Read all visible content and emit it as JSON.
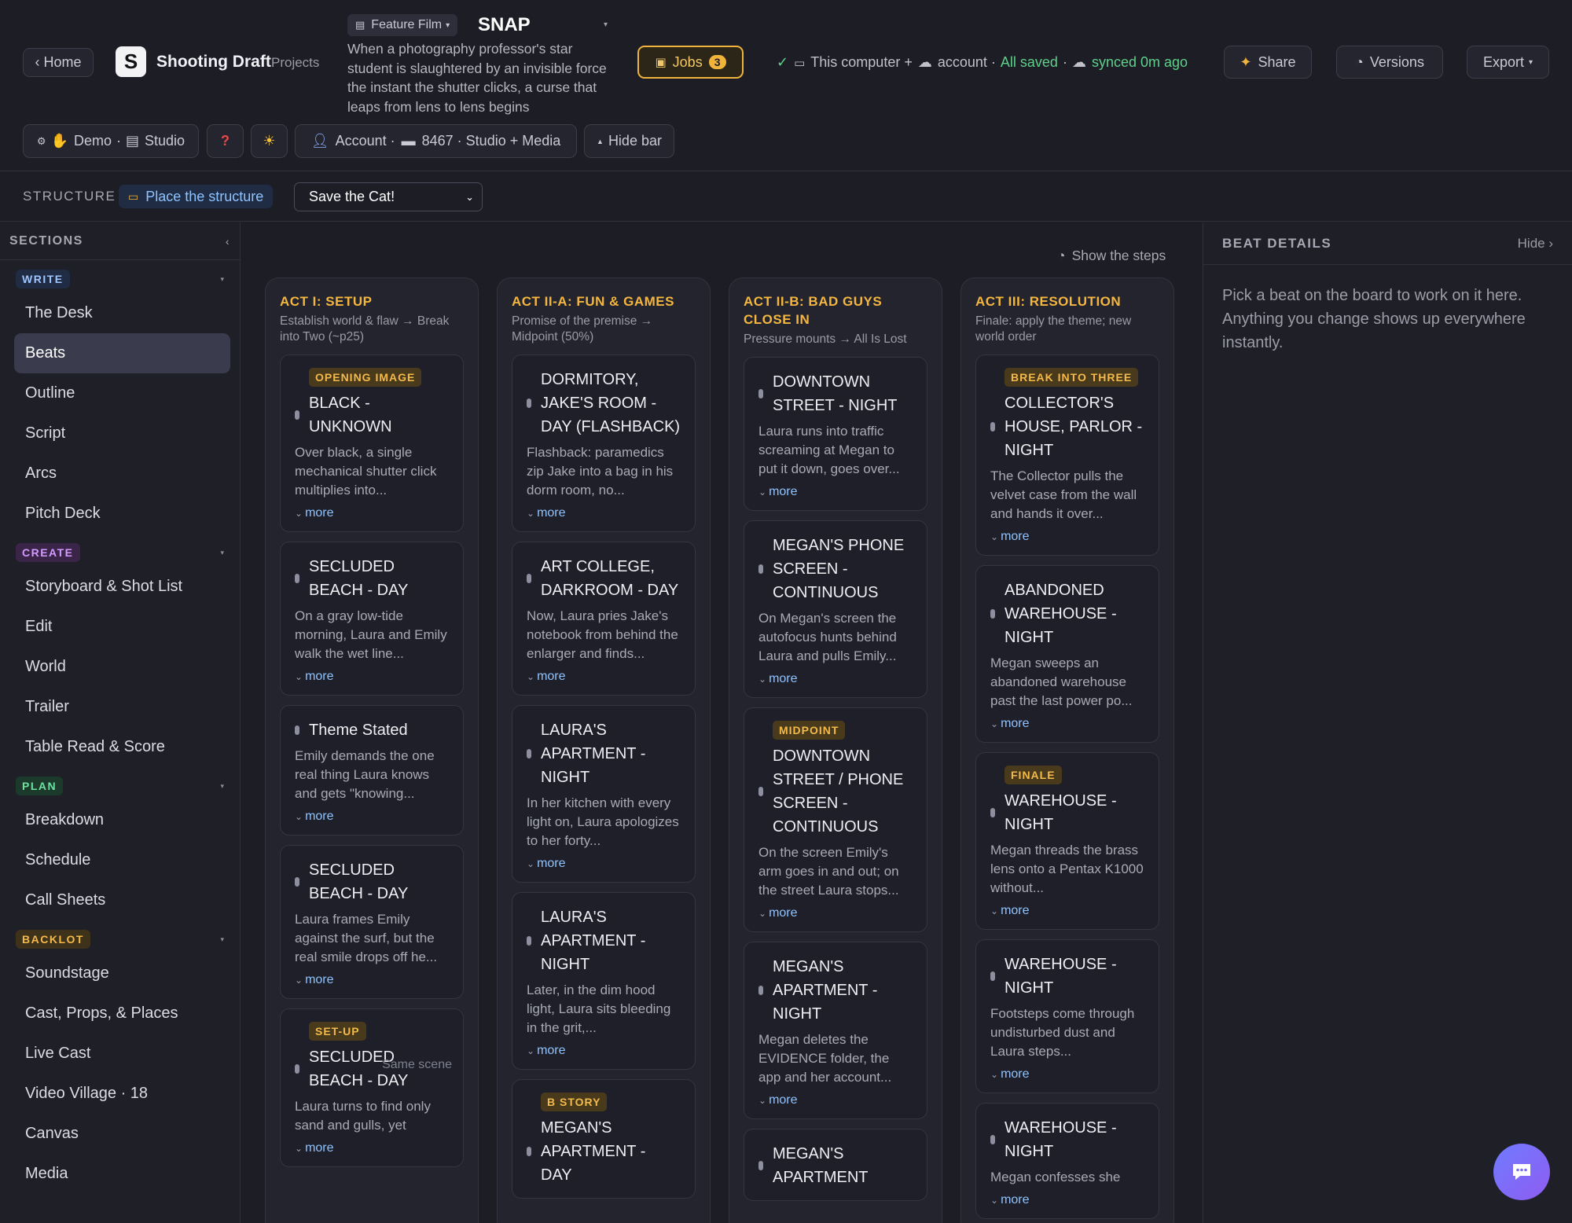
{
  "header": {
    "home_label": "‹ Home",
    "app_name": "Shooting Draft",
    "projects_label": "Projects",
    "project_type": "Feature Film",
    "project_title": "SNAP",
    "logline": "When a photography professor's star student is slaughtered by an invisible force the instant the shutter clicks, a curse that leaps from lens to lens begins",
    "jobs_label": "Jobs",
    "jobs_count": "3",
    "sync_computer": "This computer +",
    "sync_account": "account ·",
    "sync_saved": "All saved",
    "sync_synced": "synced 0m ago",
    "share_label": "Share",
    "versions_label": "Versions",
    "export_label": "Export",
    "demo_label": "Demo",
    "studio_label": "Studio",
    "account_label": "Account ·",
    "plan_label": "8467 · Studio + Media",
    "hide_bar_label": "Hide bar"
  },
  "structure": {
    "label": "STRUCTURE",
    "place_label": "Place the structure",
    "selected": "Save the Cat!"
  },
  "sidebar": {
    "title": "SECTIONS",
    "groups": [
      {
        "name": "WRITE",
        "color": "#9fc5ff",
        "bg": "#1f2c44",
        "items": [
          "The Desk",
          "Beats",
          "Outline",
          "Script",
          "Arcs",
          "Pitch Deck"
        ]
      },
      {
        "name": "CREATE",
        "color": "#d49bff",
        "bg": "#3a2548",
        "items": [
          "Storyboard & Shot List",
          "Edit",
          "World",
          "Trailer",
          "Table Read & Score"
        ]
      },
      {
        "name": "PLAN",
        "color": "#6fe0a0",
        "bg": "#1c3a2b",
        "items": [
          "Breakdown",
          "Schedule",
          "Call Sheets"
        ]
      },
      {
        "name": "BACKLOT",
        "color": "#f3b94a",
        "bg": "#3f321a",
        "items": [
          "Soundstage",
          "Cast, Props, & Places",
          "Live Cast",
          "Video Village · 18",
          "Canvas",
          "Media"
        ]
      }
    ],
    "active": "Beats"
  },
  "board": {
    "show_steps_label": "Show the steps",
    "more_label": "more",
    "columns": [
      {
        "title": "ACT I: SETUP",
        "subtitle": "Establish world & flaw → Break into Two (~p25)",
        "cards": [
          {
            "tag": "OPENING IMAGE",
            "scene": "BLACK - UNKNOWN",
            "desc": "Over black, a single mechanical shutter click multiplies into..."
          },
          {
            "tag": "",
            "scene": "SECLUDED BEACH - DAY",
            "desc": "On a gray low-tide morning, Laura and Emily walk the wet line..."
          },
          {
            "tag": "",
            "scene": "Theme Stated",
            "desc": "Emily demands the one real thing Laura knows and gets \"knowing..."
          },
          {
            "tag": "",
            "scene": "SECLUDED BEACH - DAY",
            "desc": "Laura frames Emily against the surf, but the real smile drops off he..."
          },
          {
            "tag": "SET-UP",
            "scene": "SECLUDED BEACH - DAY",
            "note": "Same scene",
            "desc": "Laura turns to find only sand and gulls, yet"
          }
        ]
      },
      {
        "title": "ACT II-A: FUN & GAMES",
        "subtitle": "Promise of the premise → Midpoint (50%)",
        "cards": [
          {
            "tag": "",
            "scene": "DORMITORY, JAKE'S ROOM - DAY (FLASHBACK)",
            "desc": "Flashback: paramedics zip Jake into a bag in his dorm room, no..."
          },
          {
            "tag": "",
            "scene": "ART COLLEGE, DARKROOM - DAY",
            "desc": "Now, Laura pries Jake's notebook from behind the enlarger and finds..."
          },
          {
            "tag": "",
            "scene": "LAURA'S APARTMENT - NIGHT",
            "desc": "In her kitchen with every light on, Laura apologizes to her forty..."
          },
          {
            "tag": "",
            "scene": "LAURA'S APARTMENT - NIGHT",
            "desc": "Later, in the dim hood light, Laura sits bleeding in the grit,..."
          },
          {
            "tag": "B STORY",
            "scene": "MEGAN'S APARTMENT - DAY",
            "desc": ""
          }
        ]
      },
      {
        "title": "ACT II-B: BAD GUYS CLOSE IN",
        "subtitle": "Pressure mounts → All Is Lost",
        "cards": [
          {
            "tag": "",
            "scene": "DOWNTOWN STREET - NIGHT",
            "desc": "Laura runs into traffic screaming at Megan to put it down, goes over..."
          },
          {
            "tag": "",
            "scene": "MEGAN'S PHONE SCREEN - CONTINUOUS",
            "desc": "On Megan's screen the autofocus hunts behind Laura and pulls Emily..."
          },
          {
            "tag": "MIDPOINT",
            "scene": "DOWNTOWN STREET / PHONE SCREEN - CONTINUOUS",
            "desc": "On the screen Emily's arm goes in and out; on the street Laura stops..."
          },
          {
            "tag": "",
            "scene": "MEGAN'S APARTMENT - NIGHT",
            "desc": "Megan deletes the EVIDENCE folder, the app and her account..."
          },
          {
            "tag": "",
            "scene": "MEGAN'S APARTMENT",
            "desc": ""
          }
        ]
      },
      {
        "title": "ACT III: RESOLUTION",
        "subtitle": "Finale: apply the theme; new world order",
        "cards": [
          {
            "tag": "BREAK INTO THREE",
            "scene": "COLLECTOR'S HOUSE, PARLOR - NIGHT",
            "desc": "The Collector pulls the velvet case from the wall and hands it over..."
          },
          {
            "tag": "",
            "scene": "ABANDONED WAREHOUSE - NIGHT",
            "desc": "Megan sweeps an abandoned warehouse past the last power po..."
          },
          {
            "tag": "FINALE",
            "scene": "WAREHOUSE - NIGHT",
            "desc": "Megan threads the brass lens onto a Pentax K1000 without..."
          },
          {
            "tag": "",
            "scene": "WAREHOUSE - NIGHT",
            "desc": "Footsteps come through undisturbed dust and Laura steps..."
          },
          {
            "tag": "",
            "scene": "WAREHOUSE - NIGHT",
            "desc": "Megan confesses she"
          }
        ]
      }
    ]
  },
  "details": {
    "title": "BEAT DETAILS",
    "hide_label": "Hide ›",
    "empty_text": "Pick a beat on the board to work on it here. Anything you change shows up everywhere instantly."
  }
}
